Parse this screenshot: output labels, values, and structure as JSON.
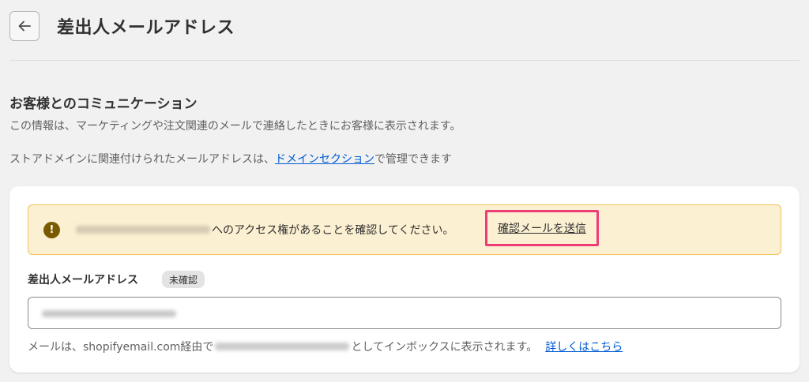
{
  "header": {
    "back_icon": "arrow-left-icon",
    "title": "差出人メールアドレス"
  },
  "section": {
    "title": "お客様とのコミュニケーション",
    "description": "この情報は、マーケティングや注文関連のメールで連絡したときにお客様に表示されます。",
    "domain_note_prefix": "ストアドメインに関連付けられたメールアドレスは、",
    "domain_note_link": "ドメインセクション",
    "domain_note_suffix": "で管理できます"
  },
  "banner": {
    "icon": "warning-icon",
    "icon_glyph": "!",
    "message": "へのアクセス権があることを確認してください。",
    "action_link": "確認メールを送信"
  },
  "sender_field": {
    "label": "差出人メールアドレス",
    "status_badge": "未確認",
    "helper_prefix": "メールは、shopifyemail.com経由で",
    "helper_suffix": "としてインボックスに表示されます。",
    "learn_more": "詳しくはこちら"
  },
  "colors": {
    "link": "#005bd3",
    "highlight_border": "#ee3c78",
    "banner_bg": "#fcf0d2",
    "banner_border": "#f0c35a"
  }
}
